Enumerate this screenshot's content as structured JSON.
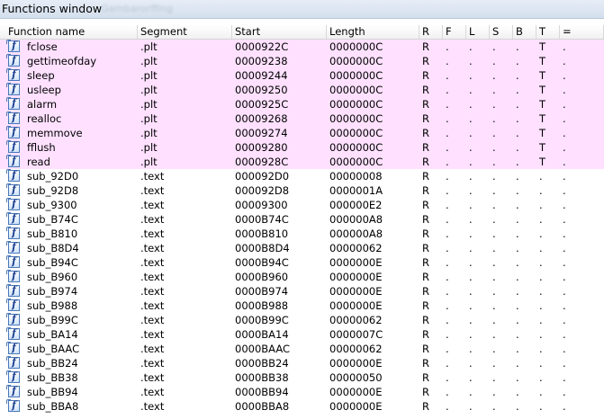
{
  "window": {
    "title": "Functions window",
    "background_title": "Gambarorffing"
  },
  "colors": {
    "plt_highlight": "#ffe1ff",
    "icon_border": "#4a78b8",
    "icon_glyph": "#1d3f8f"
  },
  "columns": [
    {
      "key": "name",
      "label": "Function name"
    },
    {
      "key": "segment",
      "label": "Segment"
    },
    {
      "key": "start",
      "label": "Start"
    },
    {
      "key": "length",
      "label": "Length"
    },
    {
      "key": "r",
      "label": "R"
    },
    {
      "key": "f",
      "label": "F"
    },
    {
      "key": "l",
      "label": "L"
    },
    {
      "key": "s",
      "label": "S"
    },
    {
      "key": "b",
      "label": "B"
    },
    {
      "key": "t",
      "label": "T"
    },
    {
      "key": "eq",
      "label": "="
    }
  ],
  "icon": {
    "name": "function-icon",
    "glyph": "f"
  },
  "rows": [
    {
      "name": "fclose",
      "segment": ".plt",
      "start": "0000922C",
      "length": "0000000C",
      "r": "R",
      "f": ".",
      "l": ".",
      "s": ".",
      "b": ".",
      "t": "T",
      "eq": "."
    },
    {
      "name": "gettimeofday",
      "segment": ".plt",
      "start": "00009238",
      "length": "0000000C",
      "r": "R",
      "f": ".",
      "l": ".",
      "s": ".",
      "b": ".",
      "t": "T",
      "eq": "."
    },
    {
      "name": "sleep",
      "segment": ".plt",
      "start": "00009244",
      "length": "0000000C",
      "r": "R",
      "f": ".",
      "l": ".",
      "s": ".",
      "b": ".",
      "t": "T",
      "eq": "."
    },
    {
      "name": "usleep",
      "segment": ".plt",
      "start": "00009250",
      "length": "0000000C",
      "r": "R",
      "f": ".",
      "l": ".",
      "s": ".",
      "b": ".",
      "t": "T",
      "eq": "."
    },
    {
      "name": "alarm",
      "segment": ".plt",
      "start": "0000925C",
      "length": "0000000C",
      "r": "R",
      "f": ".",
      "l": ".",
      "s": ".",
      "b": ".",
      "t": "T",
      "eq": "."
    },
    {
      "name": "realloc",
      "segment": ".plt",
      "start": "00009268",
      "length": "0000000C",
      "r": "R",
      "f": ".",
      "l": ".",
      "s": ".",
      "b": ".",
      "t": "T",
      "eq": "."
    },
    {
      "name": "memmove",
      "segment": ".plt",
      "start": "00009274",
      "length": "0000000C",
      "r": "R",
      "f": ".",
      "l": ".",
      "s": ".",
      "b": ".",
      "t": "T",
      "eq": "."
    },
    {
      "name": "fflush",
      "segment": ".plt",
      "start": "00009280",
      "length": "0000000C",
      "r": "R",
      "f": ".",
      "l": ".",
      "s": ".",
      "b": ".",
      "t": "T",
      "eq": "."
    },
    {
      "name": "read",
      "segment": ".plt",
      "start": "0000928C",
      "length": "0000000C",
      "r": "R",
      "f": ".",
      "l": ".",
      "s": ".",
      "b": ".",
      "t": "T",
      "eq": "."
    },
    {
      "name": "sub_92D0",
      "segment": ".text",
      "start": "000092D0",
      "length": "00000008",
      "r": "R",
      "f": ".",
      "l": ".",
      "s": ".",
      "b": ".",
      "t": ".",
      "eq": "."
    },
    {
      "name": "sub_92D8",
      "segment": ".text",
      "start": "000092D8",
      "length": "0000001A",
      "r": "R",
      "f": ".",
      "l": ".",
      "s": ".",
      "b": ".",
      "t": ".",
      "eq": "."
    },
    {
      "name": "sub_9300",
      "segment": ".text",
      "start": "00009300",
      "length": "000000E2",
      "r": "R",
      "f": ".",
      "l": ".",
      "s": ".",
      "b": ".",
      "t": ".",
      "eq": "."
    },
    {
      "name": "sub_B74C",
      "segment": ".text",
      "start": "0000B74C",
      "length": "000000A8",
      "r": "R",
      "f": ".",
      "l": ".",
      "s": ".",
      "b": ".",
      "t": ".",
      "eq": "."
    },
    {
      "name": "sub_B810",
      "segment": ".text",
      "start": "0000B810",
      "length": "000000A8",
      "r": "R",
      "f": ".",
      "l": ".",
      "s": ".",
      "b": ".",
      "t": ".",
      "eq": "."
    },
    {
      "name": "sub_B8D4",
      "segment": ".text",
      "start": "0000B8D4",
      "length": "00000062",
      "r": "R",
      "f": ".",
      "l": ".",
      "s": ".",
      "b": ".",
      "t": ".",
      "eq": "."
    },
    {
      "name": "sub_B94C",
      "segment": ".text",
      "start": "0000B94C",
      "length": "0000000E",
      "r": "R",
      "f": ".",
      "l": ".",
      "s": ".",
      "b": ".",
      "t": ".",
      "eq": "."
    },
    {
      "name": "sub_B960",
      "segment": ".text",
      "start": "0000B960",
      "length": "0000000E",
      "r": "R",
      "f": ".",
      "l": ".",
      "s": ".",
      "b": ".",
      "t": ".",
      "eq": "."
    },
    {
      "name": "sub_B974",
      "segment": ".text",
      "start": "0000B974",
      "length": "0000000E",
      "r": "R",
      "f": ".",
      "l": ".",
      "s": ".",
      "b": ".",
      "t": ".",
      "eq": "."
    },
    {
      "name": "sub_B988",
      "segment": ".text",
      "start": "0000B988",
      "length": "0000000E",
      "r": "R",
      "f": ".",
      "l": ".",
      "s": ".",
      "b": ".",
      "t": ".",
      "eq": "."
    },
    {
      "name": "sub_B99C",
      "segment": ".text",
      "start": "0000B99C",
      "length": "00000062",
      "r": "R",
      "f": ".",
      "l": ".",
      "s": ".",
      "b": ".",
      "t": ".",
      "eq": "."
    },
    {
      "name": "sub_BA14",
      "segment": ".text",
      "start": "0000BA14",
      "length": "0000007C",
      "r": "R",
      "f": ".",
      "l": ".",
      "s": ".",
      "b": ".",
      "t": ".",
      "eq": "."
    },
    {
      "name": "sub_BAAC",
      "segment": ".text",
      "start": "0000BAAC",
      "length": "00000062",
      "r": "R",
      "f": ".",
      "l": ".",
      "s": ".",
      "b": ".",
      "t": ".",
      "eq": "."
    },
    {
      "name": "sub_BB24",
      "segment": ".text",
      "start": "0000BB24",
      "length": "0000000E",
      "r": "R",
      "f": ".",
      "l": ".",
      "s": ".",
      "b": ".",
      "t": ".",
      "eq": "."
    },
    {
      "name": "sub_BB38",
      "segment": ".text",
      "start": "0000BB38",
      "length": "00000050",
      "r": "R",
      "f": ".",
      "l": ".",
      "s": ".",
      "b": ".",
      "t": ".",
      "eq": "."
    },
    {
      "name": "sub_BB94",
      "segment": ".text",
      "start": "0000BB94",
      "length": "0000000E",
      "r": "R",
      "f": ".",
      "l": ".",
      "s": ".",
      "b": ".",
      "t": ".",
      "eq": "."
    },
    {
      "name": "sub_BBA8",
      "segment": ".text",
      "start": "0000BBA8",
      "length": "0000000E",
      "r": "R",
      "f": ".",
      "l": ".",
      "s": ".",
      "b": ".",
      "t": ".",
      "eq": "."
    }
  ]
}
